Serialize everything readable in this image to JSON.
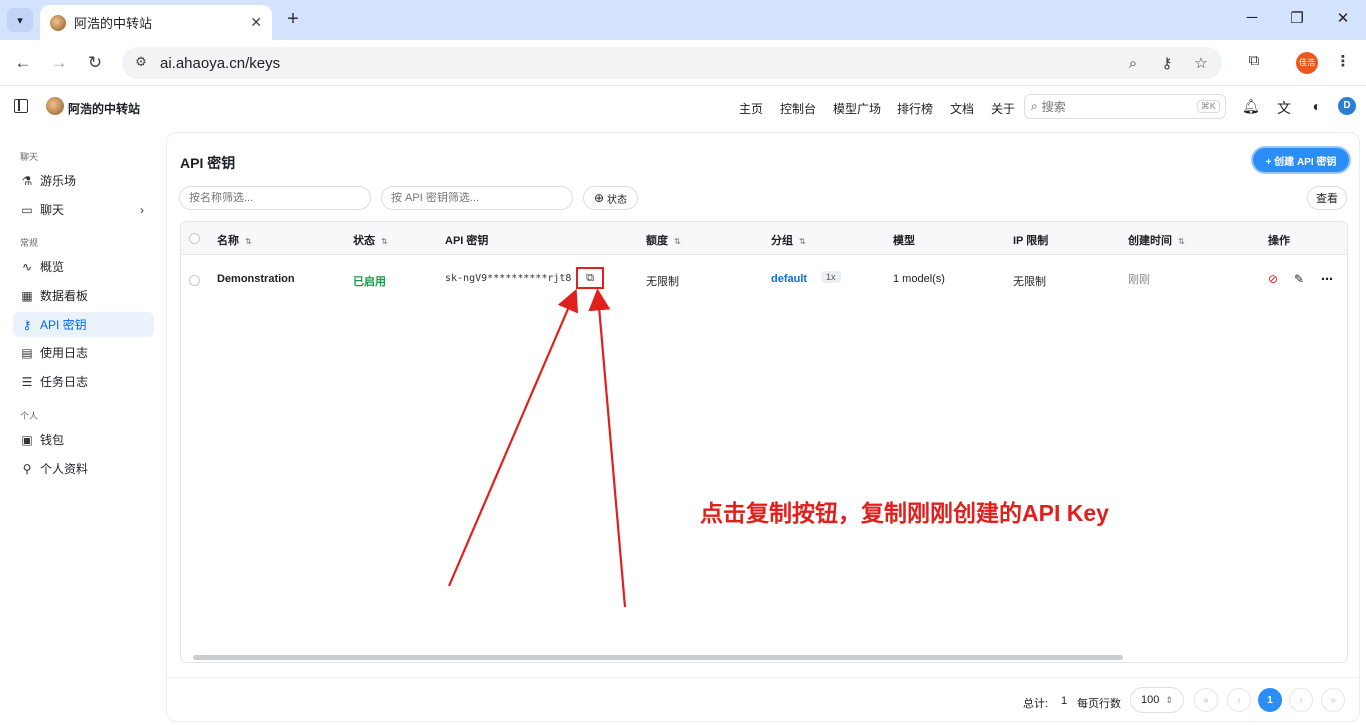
{
  "browser": {
    "tab_title": "阿浩的中转站",
    "url": "ai.ahaoya.cn/keys",
    "profile_label": "佳浩"
  },
  "header": {
    "site_name": "阿浩的中转站",
    "nav": [
      "主页",
      "控制台",
      "模型广场",
      "排行榜",
      "文档",
      "关于"
    ],
    "search_placeholder": "搜索",
    "search_shortcut": "⌘K",
    "avatar_letter": "D"
  },
  "sidebar": {
    "groups": [
      {
        "label": "聊天",
        "items": [
          {
            "label": "游乐场",
            "icon": "flask-icon"
          },
          {
            "label": "聊天",
            "icon": "chat-icon"
          }
        ]
      },
      {
        "label": "常规",
        "items": [
          {
            "label": "概览",
            "icon": "activity-icon"
          },
          {
            "label": "数据看板",
            "icon": "dashboard-icon"
          },
          {
            "label": "API 密钥",
            "icon": "key-icon"
          },
          {
            "label": "使用日志",
            "icon": "document-icon"
          },
          {
            "label": "任务日志",
            "icon": "task-list-icon"
          }
        ]
      },
      {
        "label": "个人",
        "items": [
          {
            "label": "钱包",
            "icon": "wallet-icon"
          },
          {
            "label": "个人资料",
            "icon": "user-icon"
          }
        ]
      }
    ],
    "active": "API 密钥"
  },
  "main": {
    "title": "API 密钥",
    "create_button": "+ 创建 API 密钥",
    "filter_name_placeholder": "按名称筛选...",
    "filter_key_placeholder": "按 API 密钥筛选...",
    "status_filter": "状态",
    "view_button": "查看",
    "columns": [
      "名称",
      "状态",
      "API 密钥",
      "额度",
      "分组",
      "模型",
      "IP 限制",
      "创建时间",
      "操作"
    ],
    "rows": [
      {
        "name": "Demonstration",
        "status": "已启用",
        "key": "sk-ngV9**********rjt8",
        "quota": "无限制",
        "group": "default",
        "ratio": "1x",
        "models": "1 model(s)",
        "ip_limit": "无限制",
        "created": "刚刚"
      }
    ],
    "pagination": {
      "total_label": "总计:",
      "total": "1",
      "rows_per_page_label": "每页行数",
      "page_size": "100",
      "current_page": "1"
    }
  },
  "annotation": {
    "text": "点击复制按钮，复制刚刚创建的API Key",
    "color": "#e0201c"
  }
}
